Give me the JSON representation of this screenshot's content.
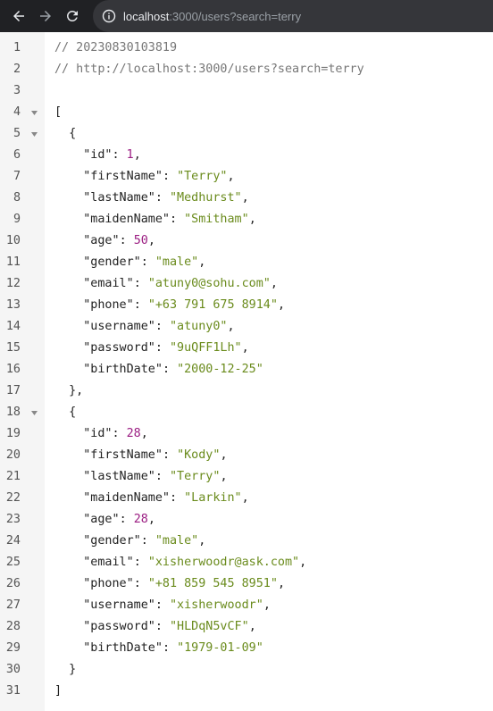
{
  "browser": {
    "url_host": "localhost",
    "url_rest": ":3000/users?search=terry",
    "icons": {
      "back": "arrow-left-icon",
      "forward": "arrow-right-icon",
      "reload": "reload-icon",
      "info": "info-icon"
    }
  },
  "lines": [
    {
      "n": "1",
      "text": "// 20230830103819"
    },
    {
      "n": "2",
      "text": "// http://localhost:3000/users?search=terry"
    },
    {
      "n": "3",
      "text": ""
    },
    {
      "n": "4",
      "text": "["
    },
    {
      "n": "5",
      "text": "  {"
    },
    {
      "n": "6",
      "key": "\"id\"",
      "val": "1",
      "t": "num"
    },
    {
      "n": "7",
      "key": "\"firstName\"",
      "val": "\"Terry\"",
      "t": "str"
    },
    {
      "n": "8",
      "key": "\"lastName\"",
      "val": "\"Medhurst\"",
      "t": "str"
    },
    {
      "n": "9",
      "key": "\"maidenName\"",
      "val": "\"Smitham\"",
      "t": "str"
    },
    {
      "n": "10",
      "key": "\"age\"",
      "val": "50",
      "t": "num"
    },
    {
      "n": "11",
      "key": "\"gender\"",
      "val": "\"male\"",
      "t": "str"
    },
    {
      "n": "12",
      "key": "\"email\"",
      "val": "\"atuny0@sohu.com\"",
      "t": "str"
    },
    {
      "n": "13",
      "key": "\"phone\"",
      "val": "\"+63 791 675 8914\"",
      "t": "str"
    },
    {
      "n": "14",
      "key": "\"username\"",
      "val": "\"atuny0\"",
      "t": "str"
    },
    {
      "n": "15",
      "key": "\"password\"",
      "val": "\"9uQFF1Lh\"",
      "t": "str"
    },
    {
      "n": "16",
      "key": "\"birthDate\"",
      "val": "\"2000-12-25\"",
      "t": "str",
      "last": true
    },
    {
      "n": "17",
      "text": "  },"
    },
    {
      "n": "18",
      "text": "  {"
    },
    {
      "n": "19",
      "key": "\"id\"",
      "val": "28",
      "t": "num"
    },
    {
      "n": "20",
      "key": "\"firstName\"",
      "val": "\"Kody\"",
      "t": "str"
    },
    {
      "n": "21",
      "key": "\"lastName\"",
      "val": "\"Terry\"",
      "t": "str"
    },
    {
      "n": "22",
      "key": "\"maidenName\"",
      "val": "\"Larkin\"",
      "t": "str"
    },
    {
      "n": "23",
      "key": "\"age\"",
      "val": "28",
      "t": "num"
    },
    {
      "n": "24",
      "key": "\"gender\"",
      "val": "\"male\"",
      "t": "str"
    },
    {
      "n": "25",
      "key": "\"email\"",
      "val": "\"xisherwoodr@ask.com\"",
      "t": "str"
    },
    {
      "n": "26",
      "key": "\"phone\"",
      "val": "\"+81 859 545 8951\"",
      "t": "str"
    },
    {
      "n": "27",
      "key": "\"username\"",
      "val": "\"xisherwoodr\"",
      "t": "str"
    },
    {
      "n": "28",
      "key": "\"password\"",
      "val": "\"HLDqN5vCF\"",
      "t": "str"
    },
    {
      "n": "29",
      "key": "\"birthDate\"",
      "val": "\"1979-01-09\"",
      "t": "str",
      "last": true
    },
    {
      "n": "30",
      "text": "  }"
    },
    {
      "n": "31",
      "text": "]"
    }
  ],
  "fold_lines": [
    "4",
    "5",
    "18"
  ],
  "colors": {
    "toolbar": "#202124",
    "omnibox": "#35363a",
    "string": "#6a8b1c",
    "number": "#9b1d82",
    "comment": "#777777"
  }
}
